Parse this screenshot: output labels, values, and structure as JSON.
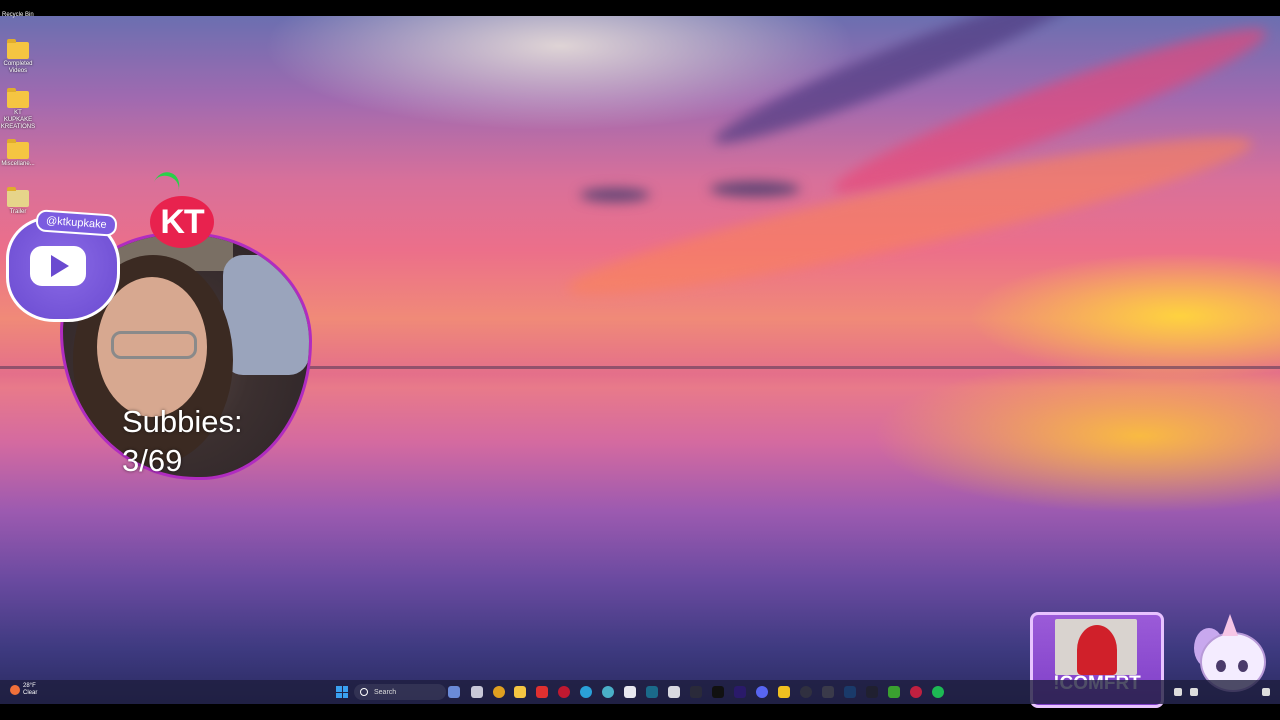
{
  "desktop": {
    "recycle_bin": "Recycle Bin",
    "icons": [
      {
        "label": "Completed Videos"
      },
      {
        "label": "KT KUPKAKE KREATIONS"
      },
      {
        "label": "Miscellane..."
      },
      {
        "label": "Trailer"
      }
    ]
  },
  "overlay": {
    "kt_logo": "KT",
    "youtube_handle": "@ktkupkake",
    "subbies_label": "Subbies:",
    "subbies_count": "3/69",
    "comfrt_label": "!COMFRT"
  },
  "taskbar": {
    "weather_temp": "28°F",
    "weather_cond": "Clear",
    "search_placeholder": "Search",
    "pinned_icons": [
      "copilot-icon",
      "task-view-icon",
      "chrome-icon",
      "file-explorer-icon",
      "red-app-icon",
      "opera-icon",
      "edge-icon",
      "globe-icon",
      "chat-icon",
      "photoshop-icon",
      "calculator-icon",
      "capcut-icon",
      "tiktok-icon",
      "premiere-icon",
      "discord-icon",
      "elgato-icon",
      "obs-icon",
      "stream-deck-icon",
      "steam-icon",
      "capcut-alt-icon",
      "xbox-icon",
      "microphone-icon",
      "spotify-icon"
    ],
    "colors": {
      "chrome": "#e0a020",
      "discord": "#5865f2",
      "spotify": "#1db954",
      "edge": "#2aa0d8",
      "xbox": "#3aa030"
    }
  }
}
